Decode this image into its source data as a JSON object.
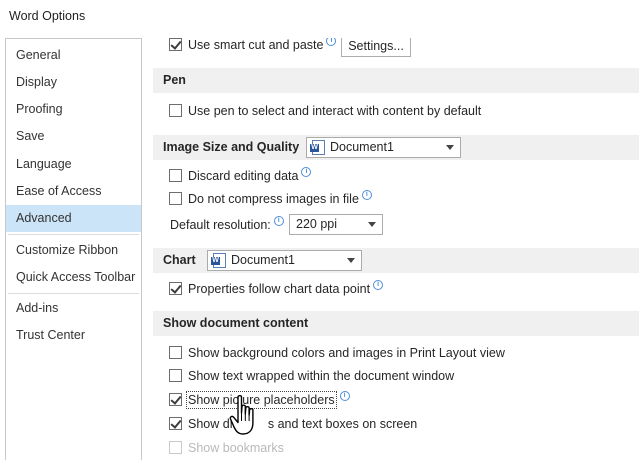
{
  "window": {
    "title": "Word Options"
  },
  "sidebar": {
    "items": [
      {
        "label": "General"
      },
      {
        "label": "Display"
      },
      {
        "label": "Proofing"
      },
      {
        "label": "Save"
      },
      {
        "label": "Language"
      },
      {
        "label": "Ease of Access"
      },
      {
        "label": "Advanced",
        "selected": true
      },
      {
        "label": "Customize Ribbon"
      },
      {
        "label": "Quick Access Toolbar"
      },
      {
        "label": "Add-ins"
      },
      {
        "label": "Trust Center"
      }
    ]
  },
  "content": {
    "smart_cut": {
      "label": "Use smart cut and paste",
      "checked": true,
      "settings_button": "Settings..."
    },
    "pen": {
      "heading": "Pen",
      "use_pen": {
        "label": "Use pen to select and interact with content by default",
        "checked": false
      }
    },
    "image_size": {
      "heading": "Image Size and Quality",
      "document": "Document1",
      "discard_editing": {
        "label": "Discard editing data",
        "checked": false
      },
      "no_compress": {
        "label": "Do not compress images in file",
        "checked": false
      },
      "default_resolution_label": "Default resolution:",
      "default_resolution_value": "220 ppi"
    },
    "chart": {
      "heading": "Chart",
      "document": "Document1",
      "properties_follow": {
        "label": "Properties follow chart data point",
        "checked": true
      }
    },
    "show_document_content": {
      "heading": "Show document content",
      "background_colors": {
        "label": "Show background colors and images in Print Layout view",
        "checked": false
      },
      "text_wrapped": {
        "label": "Show text wrapped within the document window",
        "checked": false
      },
      "picture_placeholders": {
        "label": "Show picture placeholders",
        "checked": true
      },
      "drawings_text_boxes": {
        "label": "Show drawings and text boxes on screen",
        "label_visible": "Show dr",
        "label_visible_end": "s and text boxes on screen",
        "checked": true
      },
      "bookmarks": {
        "label": "Show bookmarks",
        "checked": false
      }
    }
  },
  "colors": {
    "selected_item_bg": "#cce4f7",
    "section_bg": "#f0f0f0",
    "info_icon": "#4f8fd6"
  },
  "icons": {
    "info": "info-icon",
    "word_document": "word-document-icon",
    "hand_cursor": "hand-pointer-cursor"
  }
}
